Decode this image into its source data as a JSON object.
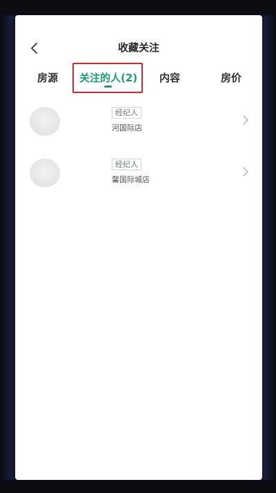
{
  "header": {
    "title": "收藏关注",
    "back_icon": "chevron-left-icon"
  },
  "tabs": [
    {
      "label": "房源",
      "active": false
    },
    {
      "label": "关注的人(2)",
      "active": true
    },
    {
      "label": "内容",
      "active": false
    },
    {
      "label": "房价",
      "active": false
    }
  ],
  "list": [
    {
      "role": "经纪人",
      "store": "河国际店"
    },
    {
      "role": "经纪人",
      "store": "馨国际城店"
    }
  ],
  "colors": {
    "accent": "#1d9b7a",
    "highlight_box": "#d8242c"
  }
}
